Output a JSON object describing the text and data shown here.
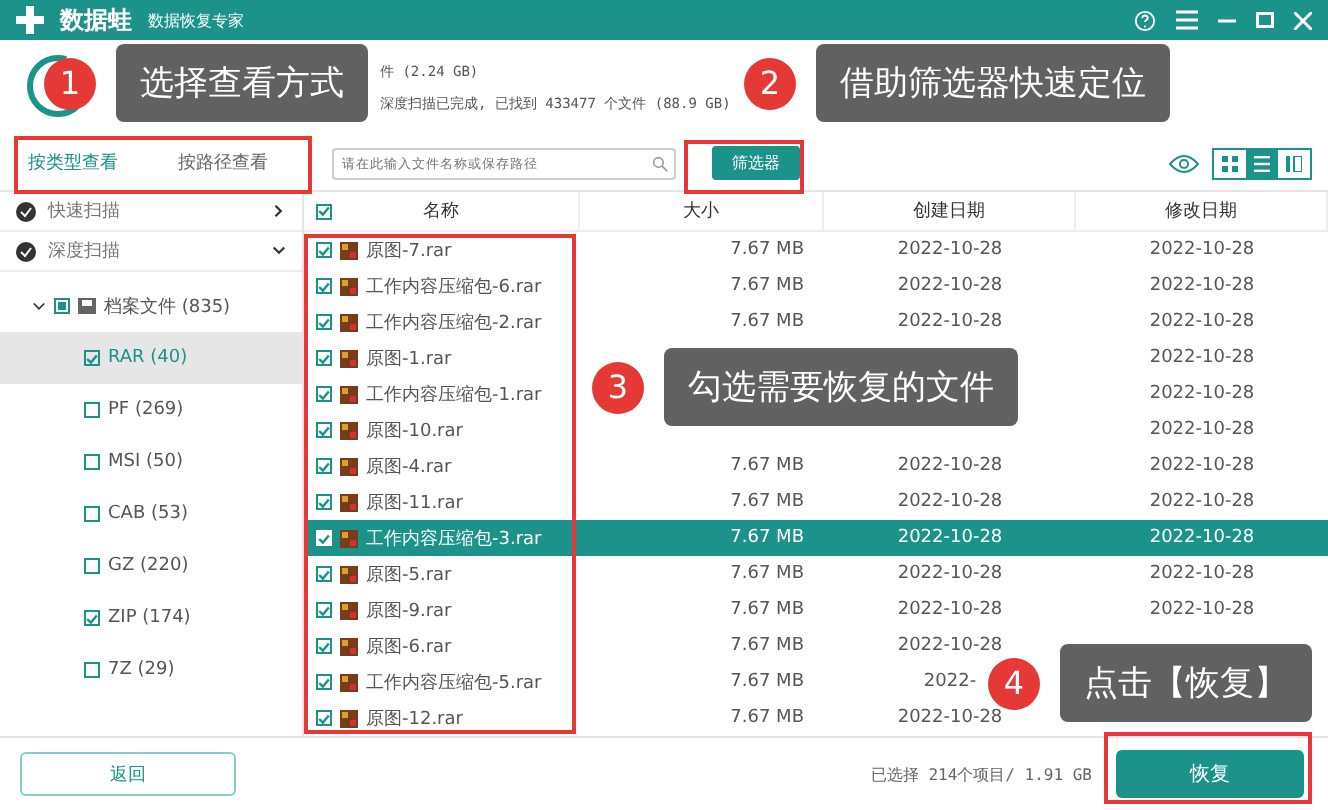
{
  "window": {
    "app_name": "数据蛙",
    "subtitle": "数据恢复专家"
  },
  "scan_status": [
    "件 (2.24 GB)",
    "深度扫描已完成, 已找到 433477 个文件 (88.9 GB)"
  ],
  "view_tabs": [
    {
      "label": "按类型查看",
      "selected": true
    },
    {
      "label": "按路径查看",
      "selected": false
    }
  ],
  "search": {
    "placeholder": "请在此输入文件名称或保存路径"
  },
  "filter_button": "筛选器",
  "view_modes": [
    {
      "kind": "grid",
      "selected": false
    },
    {
      "kind": "list",
      "selected": true
    },
    {
      "kind": "detail",
      "selected": false
    }
  ],
  "scans": [
    {
      "label": "快速扫描",
      "expanded": false
    },
    {
      "label": "深度扫描",
      "expanded": true
    }
  ],
  "tree": {
    "label": "档案文件 (835)",
    "expanded": true,
    "partial": true,
    "children": [
      {
        "label": "RAR (40)",
        "checked": true,
        "selected": true
      },
      {
        "label": "PF (269)",
        "checked": false,
        "selected": false
      },
      {
        "label": "MSI (50)",
        "checked": false,
        "selected": false
      },
      {
        "label": "CAB (53)",
        "checked": false,
        "selected": false
      },
      {
        "label": "GZ (220)",
        "checked": false,
        "selected": false
      },
      {
        "label": "ZIP (174)",
        "checked": true,
        "selected": false
      },
      {
        "label": "7Z (29)",
        "checked": false,
        "selected": false
      }
    ]
  },
  "table": {
    "columns": [
      "名称",
      "大小",
      "创建日期",
      "修改日期"
    ],
    "all_checked": true,
    "rows": [
      {
        "name": "原图-7.rar",
        "size": "7.67 MB",
        "created": "2022-10-28",
        "modified": "2022-10-28",
        "checked": true,
        "selected": false
      },
      {
        "name": "工作内容压缩包-6.rar",
        "size": "7.67 MB",
        "created": "2022-10-28",
        "modified": "2022-10-28",
        "checked": true,
        "selected": false
      },
      {
        "name": "工作内容压缩包-2.rar",
        "size": "7.67 MB",
        "created": "2022-10-28",
        "modified": "2022-10-28",
        "checked": true,
        "selected": false
      },
      {
        "name": "原图-1.rar",
        "size": "",
        "created": "",
        "modified": "2022-10-28",
        "checked": true,
        "selected": false
      },
      {
        "name": "工作内容压缩包-1.rar",
        "size": "",
        "created": "",
        "modified": "2022-10-28",
        "checked": true,
        "selected": false
      },
      {
        "name": "原图-10.rar",
        "size": "",
        "created": "",
        "modified": "2022-10-28",
        "checked": true,
        "selected": false
      },
      {
        "name": "原图-4.rar",
        "size": "7.67 MB",
        "created": "2022-10-28",
        "modified": "2022-10-28",
        "checked": true,
        "selected": false
      },
      {
        "name": "原图-11.rar",
        "size": "7.67 MB",
        "created": "2022-10-28",
        "modified": "2022-10-28",
        "checked": true,
        "selected": false
      },
      {
        "name": "工作内容压缩包-3.rar",
        "size": "7.67 MB",
        "created": "2022-10-28",
        "modified": "2022-10-28",
        "checked": true,
        "selected": true
      },
      {
        "name": "原图-5.rar",
        "size": "7.67 MB",
        "created": "2022-10-28",
        "modified": "2022-10-28",
        "checked": true,
        "selected": false
      },
      {
        "name": "原图-9.rar",
        "size": "7.67 MB",
        "created": "2022-10-28",
        "modified": "2022-10-28",
        "checked": true,
        "selected": false
      },
      {
        "name": "原图-6.rar",
        "size": "7.67 MB",
        "created": "2022-10-28",
        "modified": "",
        "checked": true,
        "selected": false
      },
      {
        "name": "工作内容压缩包-5.rar",
        "size": "7.67 MB",
        "created": "2022-",
        "modified": "",
        "checked": true,
        "selected": false
      },
      {
        "name": "原图-12.rar",
        "size": "7.67 MB",
        "created": "2022-10-28",
        "modified": "",
        "checked": true,
        "selected": false
      }
    ]
  },
  "back_button": "返回",
  "selection_summary": "已选择 214个项目/ 1.91 GB",
  "recover_button": "恢复",
  "callouts": [
    {
      "number": "1",
      "text": "选择查看方式"
    },
    {
      "number": "2",
      "text": "借助筛选器快速定位"
    },
    {
      "number": "3",
      "text": "勾选需要恢复的文件"
    },
    {
      "number": "4",
      "text": "点击【恢复】"
    }
  ]
}
